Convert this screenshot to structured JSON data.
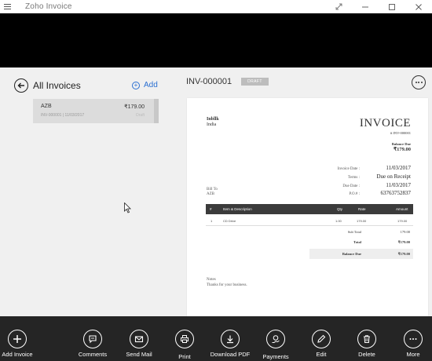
{
  "window": {
    "title": "Zoho Invoice"
  },
  "list": {
    "title": "All Invoices",
    "add_label": "Add",
    "items": [
      {
        "customer": "AZB",
        "amount": "₹179.00",
        "meta": "INV-000001 | 11/03/2017",
        "status": "Draft"
      }
    ]
  },
  "detail": {
    "invoice_number": "INV-000001",
    "status_badge": "DRAFT",
    "document": {
      "org_name": "Inbllk",
      "org_country": "India",
      "title": "INVOICE",
      "number_line": "# INV-000001",
      "balance_due_label": "Balance Due",
      "balance_due_value": "₹179.00",
      "fields": [
        {
          "label": "Invoice Date :",
          "value": "11/03/2017"
        },
        {
          "label": "Terms :",
          "value": "Due on Receipt"
        },
        {
          "label": "Due Date :",
          "value": "11/03/2017"
        },
        {
          "label": "P.O.# :",
          "value": "63763752837"
        }
      ],
      "bill_to_label": "Bill To",
      "bill_to_name": "AZB",
      "table": {
        "headers": [
          "#",
          "Item & Description",
          "Qty",
          "Rate",
          "Amount"
        ],
        "rows": [
          [
            "1",
            "CD Drive",
            "1.00",
            "179.00",
            "179.00"
          ]
        ]
      },
      "sub_total_label": "Sub Total",
      "sub_total_value": "179.00",
      "total_label": "Total",
      "total_value": "₹179.00",
      "balance_label": "Balance Due",
      "balance_value": "₹179.00",
      "notes_label": "Notes",
      "notes_text": "Thanks for your business."
    }
  },
  "appbar": {
    "buttons": [
      {
        "label": "Add Invoice",
        "icon": "plus-icon"
      },
      {
        "label": "Comments",
        "icon": "comment-icon"
      },
      {
        "label": "Send Mail",
        "icon": "mail-icon"
      },
      {
        "label": "Print",
        "icon": "printer-icon"
      },
      {
        "label": "Download PDF",
        "icon": "download-icon"
      },
      {
        "label": "Payments",
        "icon": "payment-icon"
      },
      {
        "label": "Edit",
        "icon": "pencil-icon"
      },
      {
        "label": "Delete",
        "icon": "trash-icon"
      },
      {
        "label": "More",
        "icon": "more-icon"
      }
    ]
  }
}
